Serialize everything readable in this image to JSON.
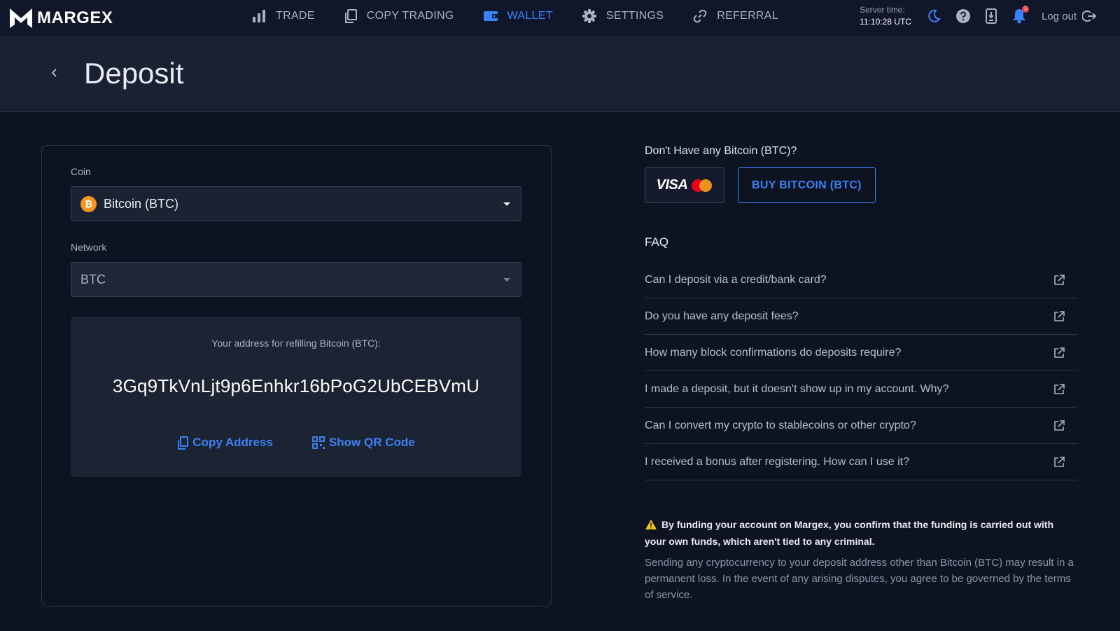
{
  "app": {
    "logo_text": "MARGEX"
  },
  "nav": {
    "items": [
      {
        "label": "TRADE",
        "icon": "bar-chart-icon",
        "active": false
      },
      {
        "label": "COPY TRADING",
        "icon": "copy-icon",
        "active": false
      },
      {
        "label": "WALLET",
        "icon": "wallet-icon",
        "active": true
      },
      {
        "label": "SETTINGS",
        "icon": "gear-icon",
        "active": false
      },
      {
        "label": "REFERRAL",
        "icon": "link-icon",
        "active": false
      }
    ]
  },
  "header": {
    "server_time_label": "Server time:",
    "server_time_value": "11:10:28 UTC",
    "notification_count": "1",
    "logout_label": "Log out"
  },
  "page": {
    "title": "Deposit"
  },
  "deposit": {
    "coin_label": "Coin",
    "coin_value": "Bitcoin (BTC)",
    "coin_icon_glyph": "₿",
    "network_label": "Network",
    "network_value": "BTC",
    "address_label": "Your address for refilling Bitcoin (BTC):",
    "address_value": "3Gq9TkVnLjt9p6Enhkr16bPoG2UbCEBVmU",
    "copy_label": "Copy Address",
    "qr_label": "Show QR Code"
  },
  "buy": {
    "title": "Don't Have any Bitcoin (BTC)?",
    "visa_text": "VISA",
    "button_label": "BUY BITCOIN (BTC)"
  },
  "faq": {
    "title": "FAQ",
    "items": [
      "Can I deposit via a credit/bank card?",
      "Do you have any deposit fees?",
      "How many block confirmations do deposits require?",
      "I made a deposit, but it doesn't show up in my account. Why?",
      "Can I convert my crypto to stablecoins or other crypto?",
      "I received a bonus after registering. How can I use it?"
    ]
  },
  "notice": {
    "bold": "By funding your account on Margex, you confirm that the funding is carried out with your own funds, which aren't tied to any criminal.",
    "text": "Sending any cryptocurrency to your deposit address other than Bitcoin (BTC) may result in a permanent loss. In the event of any arising disputes, you agree to be governed by the terms of service."
  },
  "colors": {
    "accent": "#3b82f6",
    "background": "#0e1322",
    "bitcoin": "#f7931a",
    "warning": "#f5c518"
  }
}
